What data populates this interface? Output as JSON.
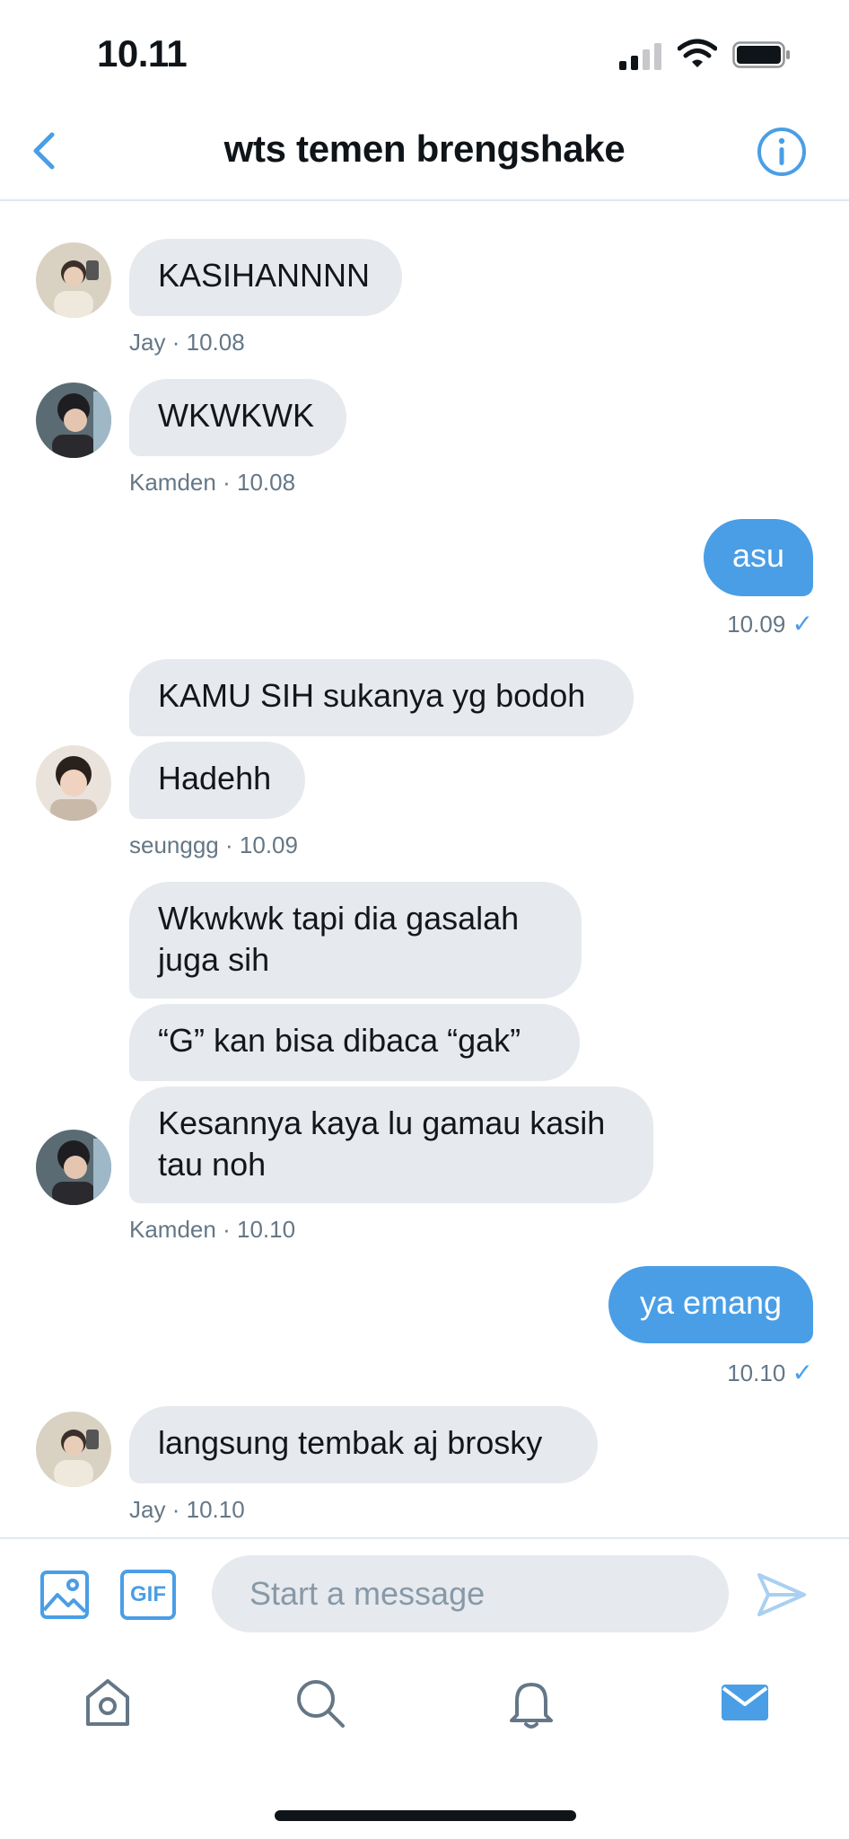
{
  "status_bar": {
    "time": "10.11"
  },
  "header": {
    "title": "wts temen brengshake"
  },
  "conversation": {
    "g1": {
      "text": "KASIHANNNN",
      "sender": "Jay",
      "time": "10.08"
    },
    "g2": {
      "text": "WKWKWK",
      "sender": "Kamden",
      "time": "10.08"
    },
    "g3": {
      "text": "asu",
      "time": "10.09",
      "check": "✓"
    },
    "g4": {
      "m1": "KAMU SIH sukanya yg bodoh",
      "m2": "Hadehh",
      "sender": "seunggg",
      "time": "10.09"
    },
    "g5": {
      "m1": "Wkwkwk tapi dia gasalah\njuga sih",
      "m2": "“G” kan bisa dibaca “gak”",
      "m3": "Kesannya kaya lu gamau kasih\ntau noh",
      "sender": "Kamden",
      "time": "10.10"
    },
    "g6": {
      "text": "ya emang",
      "time": "10.10",
      "check": "✓"
    },
    "g7": {
      "text": "langsung tembak aj brosky",
      "sender": "Jay",
      "time": "10.10"
    },
    "separator": "·"
  },
  "composer": {
    "placeholder": "Start a message",
    "gif_label": "GIF"
  },
  "tabs": [
    "home-icon",
    "search-icon",
    "bell-icon",
    "mail-icon"
  ],
  "colors": {
    "accent": "#4a9ee6",
    "bubble_in": "#e6e9ee",
    "meta": "#657786"
  }
}
